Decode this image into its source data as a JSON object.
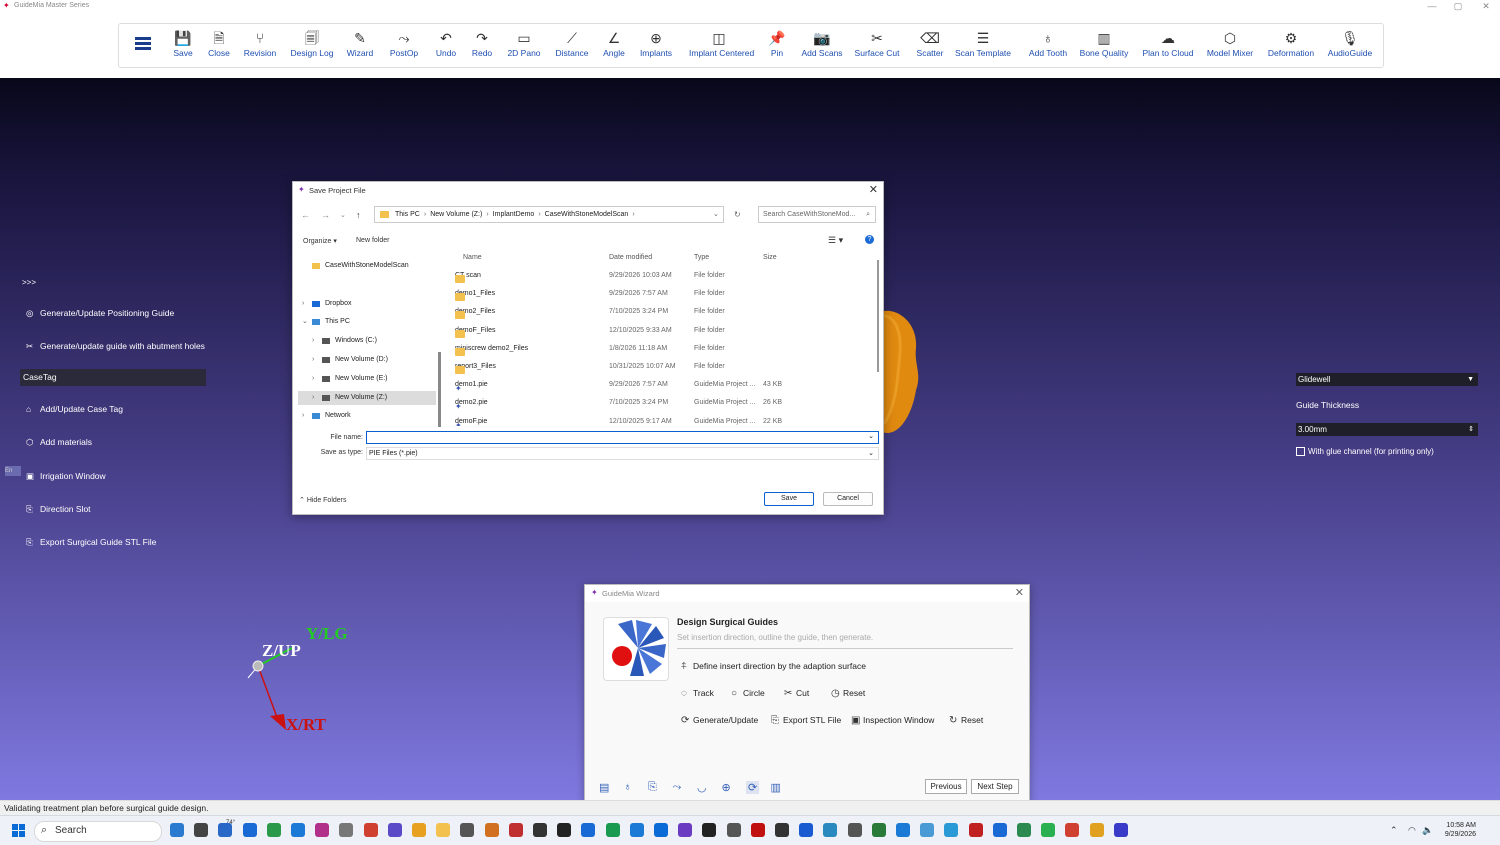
{
  "app": {
    "title": "GuideMia Master Series",
    "win_min": "—",
    "win_max": "▢",
    "win_close": "✕"
  },
  "toolbar": [
    {
      "label": "Save",
      "icon": "save-icon",
      "glyph": "💾"
    },
    {
      "label": "Close",
      "icon": "close-file-icon",
      "glyph": "🗎"
    },
    {
      "label": "Revision",
      "icon": "revision-icon",
      "glyph": "⑂"
    },
    {
      "label": "Design Log",
      "icon": "design-log-icon",
      "glyph": "🗐"
    },
    {
      "label": "Wizard",
      "icon": "wizard-icon",
      "glyph": "✎"
    },
    {
      "label": "PostOp",
      "icon": "postop-icon",
      "glyph": "⤳"
    },
    {
      "label": "Undo",
      "icon": "undo-icon",
      "glyph": "↶"
    },
    {
      "label": "Redo",
      "icon": "redo-icon",
      "glyph": "↷"
    },
    {
      "label": "2D Pano",
      "icon": "pano-icon",
      "glyph": "▭"
    },
    {
      "label": "Distance",
      "icon": "distance-icon",
      "glyph": "⟋"
    },
    {
      "label": "Angle",
      "icon": "angle-icon",
      "glyph": "∠"
    },
    {
      "label": "Implants",
      "icon": "implants-icon",
      "glyph": "⊕"
    },
    {
      "label": "Implant Centered",
      "icon": "implant-centered-icon",
      "glyph": "◫"
    },
    {
      "label": "Pin",
      "icon": "pin-icon",
      "glyph": "📌"
    },
    {
      "label": "Add Scans",
      "icon": "add-scans-icon",
      "glyph": "📷"
    },
    {
      "label": "Surface Cut",
      "icon": "surface-cut-icon",
      "glyph": "✂"
    },
    {
      "label": "Scatter",
      "icon": "scatter-icon",
      "glyph": "⌫"
    },
    {
      "label": "Scan Template",
      "icon": "scan-template-icon",
      "glyph": "☰"
    },
    {
      "label": "Add Tooth",
      "icon": "add-tooth-icon",
      "glyph": "♁"
    },
    {
      "label": "Bone Quality",
      "icon": "bone-quality-icon",
      "glyph": "▥"
    },
    {
      "label": "Plan to Cloud",
      "icon": "cloud-icon",
      "glyph": "☁"
    },
    {
      "label": "Model Mixer",
      "icon": "model-mixer-icon",
      "glyph": "⬡"
    },
    {
      "label": "Deformation",
      "icon": "deformation-icon",
      "glyph": "⚙"
    },
    {
      "label": "AudioGuide",
      "icon": "audio-guide-icon",
      "glyph": "🎙"
    }
  ],
  "sidebar": {
    "toggle": ">>>",
    "items": [
      {
        "label": "Generate/Update Positioning Guide",
        "icon": "positioning-guide-icon",
        "glyph": "◎"
      },
      {
        "label": "Generate/update guide with abutment holes",
        "icon": "abutment-holes-icon",
        "glyph": "✂"
      },
      {
        "label": "Add/Update Case Tag",
        "icon": "tag-icon",
        "glyph": "⌂"
      },
      {
        "label": "Add materials",
        "icon": "materials-icon",
        "glyph": "⬡"
      },
      {
        "label": "Irrigation Window",
        "icon": "irrigation-window-icon",
        "glyph": "▣"
      },
      {
        "label": "Direction Slot",
        "icon": "direction-slot-icon",
        "glyph": "⎘"
      },
      {
        "label": "Export Surgical Guide STL File",
        "icon": "export-stl-icon",
        "glyph": "⎘"
      }
    ],
    "casetag": "CaseTag",
    "edge_tab": "En"
  },
  "right_panel": {
    "vendor": "Glidewell",
    "thickness_label": "Guide Thickness",
    "thickness": "3.00mm",
    "glue": "With glue channel (for printing only)"
  },
  "axes": {
    "y": "Y/LG",
    "z": "Z/UP",
    "x": "X/RT"
  },
  "status": "Validating treatment plan before surgical guide design.",
  "save_dialog": {
    "title": "Save Project File",
    "breadcrumb": [
      "This PC",
      "New Volume (Z:)",
      "ImplantDemo",
      "CaseWithStoneModelScan"
    ],
    "search_placeholder": "Search CaseWithStoneMod...",
    "organize": "Organize ▾",
    "new_folder": "New folder",
    "tree": [
      {
        "label": "CaseWithStoneModelScan",
        "type": "folder"
      },
      {
        "label": "Dropbox",
        "type": "dropbox"
      },
      {
        "label": "This PC",
        "type": "pc"
      },
      {
        "label": "Windows (C:)",
        "type": "drive"
      },
      {
        "label": "New Volume (D:)",
        "type": "drive"
      },
      {
        "label": "New Volume (E:)",
        "type": "drive"
      },
      {
        "label": "New Volume (Z:)",
        "type": "drive"
      },
      {
        "label": "Network",
        "type": "network"
      }
    ],
    "columns": [
      "Name",
      "Date modified",
      "Type",
      "Size"
    ],
    "rows": [
      {
        "name": "CT scan",
        "date": "9/29/2026 10:03 AM",
        "type": "File folder",
        "size": "",
        "kind": "folder"
      },
      {
        "name": "demo1_Files",
        "date": "9/29/2026 7:57 AM",
        "type": "File folder",
        "size": "",
        "kind": "folder"
      },
      {
        "name": "demo2_Files",
        "date": "7/10/2025 3:24 PM",
        "type": "File folder",
        "size": "",
        "kind": "folder"
      },
      {
        "name": "demoF_Files",
        "date": "12/10/2025 9:33 AM",
        "type": "File folder",
        "size": "",
        "kind": "folder"
      },
      {
        "name": "miniscrew demo2_Files",
        "date": "1/8/2026 11:18 AM",
        "type": "File folder",
        "size": "",
        "kind": "folder"
      },
      {
        "name": "report3_Files",
        "date": "10/31/2025 10:07 AM",
        "type": "File folder",
        "size": "",
        "kind": "folder"
      },
      {
        "name": "demo1.pie",
        "date": "9/29/2026 7:57 AM",
        "type": "GuideMia Project ...",
        "size": "43 KB",
        "kind": "pie"
      },
      {
        "name": "demo2.pie",
        "date": "7/10/2025 3:24 PM",
        "type": "GuideMia Project ...",
        "size": "26 KB",
        "kind": "pie"
      },
      {
        "name": "demoF.pie",
        "date": "12/10/2025 9:17 AM",
        "type": "GuideMia Project ...",
        "size": "22 KB",
        "kind": "pie"
      }
    ],
    "file_name_label": "File name:",
    "file_name_value": "",
    "save_type_label": "Save as type:",
    "save_type_value": "PIE Files (*.pie)",
    "hide_folders": "Hide Folders",
    "save": "Save",
    "cancel": "Cancel"
  },
  "wizard": {
    "title": "GuideMia Wizard",
    "heading": "Design Surgical Guides",
    "subtitle": "Set insertion direction, outline the guide, then generate.",
    "define": "Define insert direction by the adaption surface",
    "row1": [
      {
        "label": "Track",
        "icon": "track-icon",
        "glyph": "◌"
      },
      {
        "label": "Circle",
        "icon": "circle-icon",
        "glyph": "○"
      },
      {
        "label": "Cut",
        "icon": "cut-icon",
        "glyph": "✂"
      },
      {
        "label": "Reset",
        "icon": "reset-clock-icon",
        "glyph": "◷"
      }
    ],
    "row2": [
      {
        "label": "Generate/Update",
        "icon": "generate-icon",
        "glyph": "⟳"
      },
      {
        "label": "Export STL File",
        "icon": "export-icon",
        "glyph": "⎘"
      },
      {
        "label": "Inspection Window",
        "icon": "inspection-window-icon",
        "glyph": "▣"
      },
      {
        "label": "Reset",
        "icon": "reset-icon",
        "glyph": "↻"
      }
    ],
    "previous": "Previous",
    "next": "Next Step"
  },
  "taskbar": {
    "search": "Search",
    "time": "10:58 AM",
    "date": "9/29/2026",
    "weather": "74°"
  },
  "colors": {
    "accent": "#1f4fb0",
    "tooth": "#e08a10",
    "axis_y": "#22cc22",
    "axis_x": "#cc1111"
  }
}
